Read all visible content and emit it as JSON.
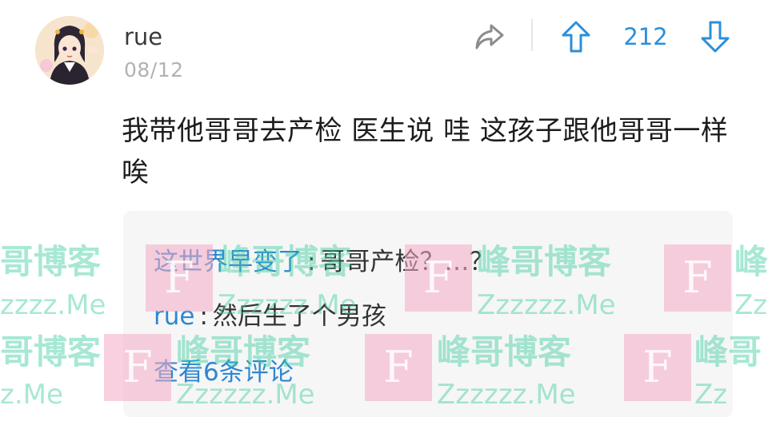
{
  "post": {
    "username": "rue",
    "date": "08/12",
    "vote_count": "212",
    "content": "我带他哥哥去产检 医生说 哇 这孩子跟他哥哥一样唉"
  },
  "icons": {
    "share": "share-icon",
    "upvote": "arrow-up-icon",
    "downvote": "arrow-down-icon"
  },
  "comments": {
    "items": [
      {
        "author": "这世界早变了",
        "separator": ":",
        "text": "哥哥产检？…？"
      },
      {
        "author": "rue",
        "separator": ":",
        "text": "然后生了个男孩"
      }
    ],
    "view_all_label": "查看6条评论"
  },
  "watermark": {
    "letter": "F",
    "cn_text": "峰哥博客",
    "cn_partial_left": "哥博客",
    "cn_partial_right": "峰",
    "cn_partial_right_2": "峰哥",
    "en_text": "Zzzzzz.Me",
    "en_partial_left": "zzzz.Me",
    "en_partial_left_2": "z.Me",
    "en_partial_right": "Zz"
  },
  "colors": {
    "accent_blue": "#2b8fd9",
    "username_gray": "#3b3b3b",
    "date_gray": "#b2b2b2",
    "comment_bg": "#f6f6f6",
    "watermark_green": "#3ccda0",
    "watermark_pink": "#f4aac4"
  }
}
